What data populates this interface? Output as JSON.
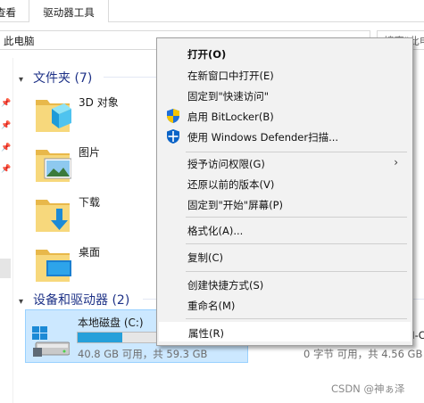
{
  "ribbon": {
    "tabs": [
      {
        "label": "查看"
      },
      {
        "label": "驱动器工具"
      }
    ]
  },
  "address": {
    "path": "此电脑",
    "search_placeholder": "搜索\"此电脑\""
  },
  "groups": {
    "folders": {
      "title": "文件夹 (7)"
    },
    "devices": {
      "title": "设备和驱动器 (2)"
    }
  },
  "folders": [
    {
      "label": "3D 对象"
    },
    {
      "label": "图片"
    },
    {
      "label": "下载"
    },
    {
      "label": "桌面"
    }
  ],
  "drives": [
    {
      "name": "本地磁盘 (C:)",
      "size_text": "40.8 GB 可用，共 59.3 GB",
      "used_fraction": 0.31
    },
    {
      "name": "H-C",
      "size_text": "0 字节 可用，共 4.56 GB"
    }
  ],
  "context_menu": {
    "items": [
      {
        "label": "打开(O)",
        "bold": true
      },
      {
        "label": "在新窗口中打开(E)"
      },
      {
        "label": "固定到\"快速访问\""
      },
      {
        "label": "启用 BitLocker(B)",
        "icon": "uac-shield-icon"
      },
      {
        "label": "使用 Windows Defender扫描...",
        "icon": "defender-shield-icon"
      },
      {
        "label": "授予访问权限(G)",
        "submenu": true
      },
      {
        "label": "还原以前的版本(V)"
      },
      {
        "label": "固定到\"开始\"屏幕(P)"
      },
      {
        "label": "格式化(A)..."
      },
      {
        "label": "复制(C)"
      },
      {
        "label": "创建快捷方式(S)"
      },
      {
        "label": "重命名(M)"
      },
      {
        "label": "属性(R)",
        "highlighted": true
      }
    ]
  },
  "watermark": "CSDN @神ぁ泽",
  "colors": {
    "accent": "#26a0da",
    "selection_bg": "#cce8ff",
    "group_header": "#1e3287",
    "menu_bg": "#f2f2f2"
  }
}
